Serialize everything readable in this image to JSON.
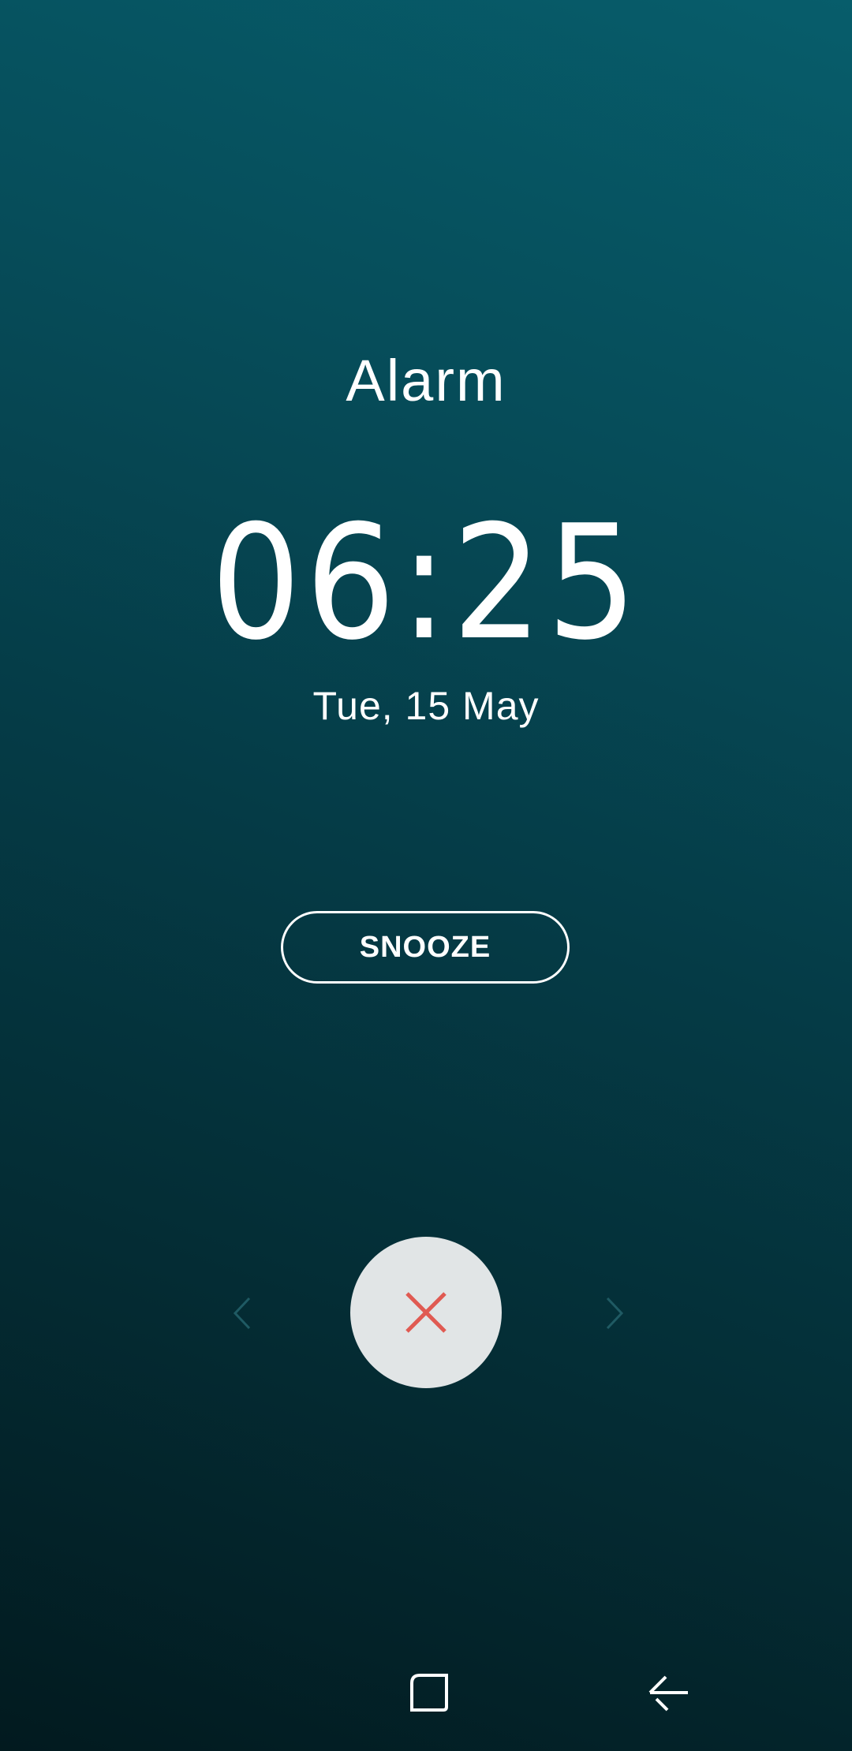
{
  "alarm": {
    "title": "Alarm",
    "time": "06:25",
    "date": "Tue, 15 May"
  },
  "actions": {
    "snooze_label": "SNOOZE",
    "dismiss_icon": "close-icon"
  },
  "hints": {
    "left_icon": "chevron-left-icon",
    "right_icon": "chevron-right-icon"
  },
  "navbar": {
    "recents_icon": "recents-icon",
    "back_icon": "back-icon"
  },
  "colors": {
    "background_top": "#075d6b",
    "background_bottom": "#021a1f",
    "dismiss_button": "#e1e5e6",
    "dismiss_x": "#e05a52",
    "text": "#ffffff"
  }
}
